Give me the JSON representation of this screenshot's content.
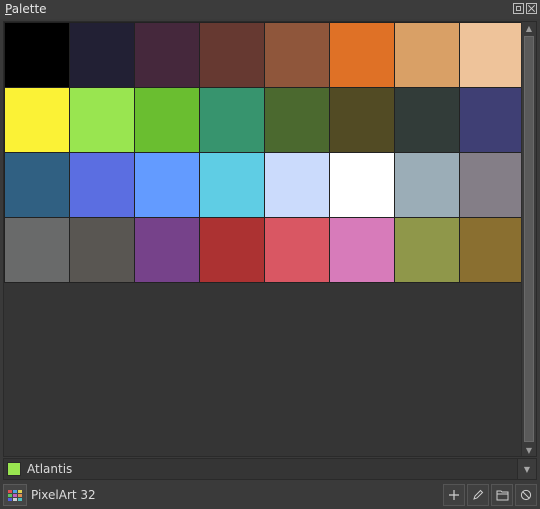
{
  "window": {
    "title_prefix": "P",
    "title_rest": "alette"
  },
  "palette": {
    "colors": [
      "#000000",
      "#222034",
      "#45283c",
      "#663931",
      "#8f563b",
      "#df7126",
      "#d9a066",
      "#eec39a",
      "#fbf236",
      "#99e550",
      "#6abe30",
      "#37946e",
      "#4b692f",
      "#524b24",
      "#323c39",
      "#3f3f74",
      "#306082",
      "#5b6ee1",
      "#639bff",
      "#5fcde4",
      "#cbdbfc",
      "#ffffff",
      "#9badb7",
      "#847e87",
      "#696a6a",
      "#595652",
      "#76428a",
      "#ac3232",
      "#d95763",
      "#d77bba",
      "#8f974a",
      "#8a6f30"
    ]
  },
  "current_color": {
    "name": "Atlantis",
    "hex": "#99e550"
  },
  "footer": {
    "palette_name": "PixelArt 32"
  },
  "icons": {
    "float": "float-icon",
    "close": "close-icon",
    "palette": "palette-icon",
    "add": "plus-icon",
    "edit": "pencil-icon",
    "load": "folder-icon",
    "clear": "circle-slash-icon"
  }
}
